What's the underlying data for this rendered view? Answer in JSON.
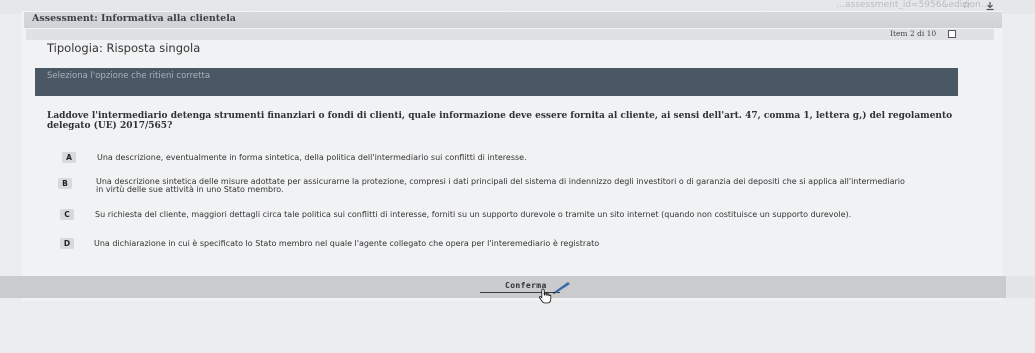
{
  "browser": {
    "url_fragment": "…assessment_id=5956&edizion…",
    "icons": [
      "star-icon",
      "download-icon"
    ]
  },
  "header": {
    "title": "Assessment: Informativa alla clientela",
    "item_counter": "Item 2 di 10"
  },
  "question_block": {
    "type_label": "Tipologia: Risposta singola",
    "instruction": "Seleziona l'opzione che ritieni corretta",
    "question": "Laddove l'intermediario detenga strumenti finanziari o fondi di clienti, quale informazione deve essere fornita al cliente, ai sensi dell'art. 47, comma 1, lettera g,) del regolamento delegato (UE) 2017/565?",
    "options": [
      {
        "letter": "A",
        "text": "Una descrizione, eventualmente in forma sintetica, della politica dell'intermediario sui conflitti di interesse."
      },
      {
        "letter": "B",
        "text_line1": "Una descrizione sintetica delle misure adottate per assicurarne la protezione, compresi i dati principali del sistema di indennizzo degli investitori o di garanzia dei depositi che si applica all'intermediario",
        "text_line2": "in virtù delle sue attività in uno Stato membro."
      },
      {
        "letter": "C",
        "text": "Su richiesta del cliente, maggiori dettagli circa tale politica sui conflitti di interesse, forniti su un supporto durevole o tramite un sito internet (quando non costituisce un supporto durevole)."
      },
      {
        "letter": "D",
        "text": "Una dichiarazione in cui è specificato lo Stato membro nel quale l'agente collegato che opera per l'interemediario è registrato"
      }
    ]
  },
  "footer": {
    "confirm_label": "Conferma"
  }
}
